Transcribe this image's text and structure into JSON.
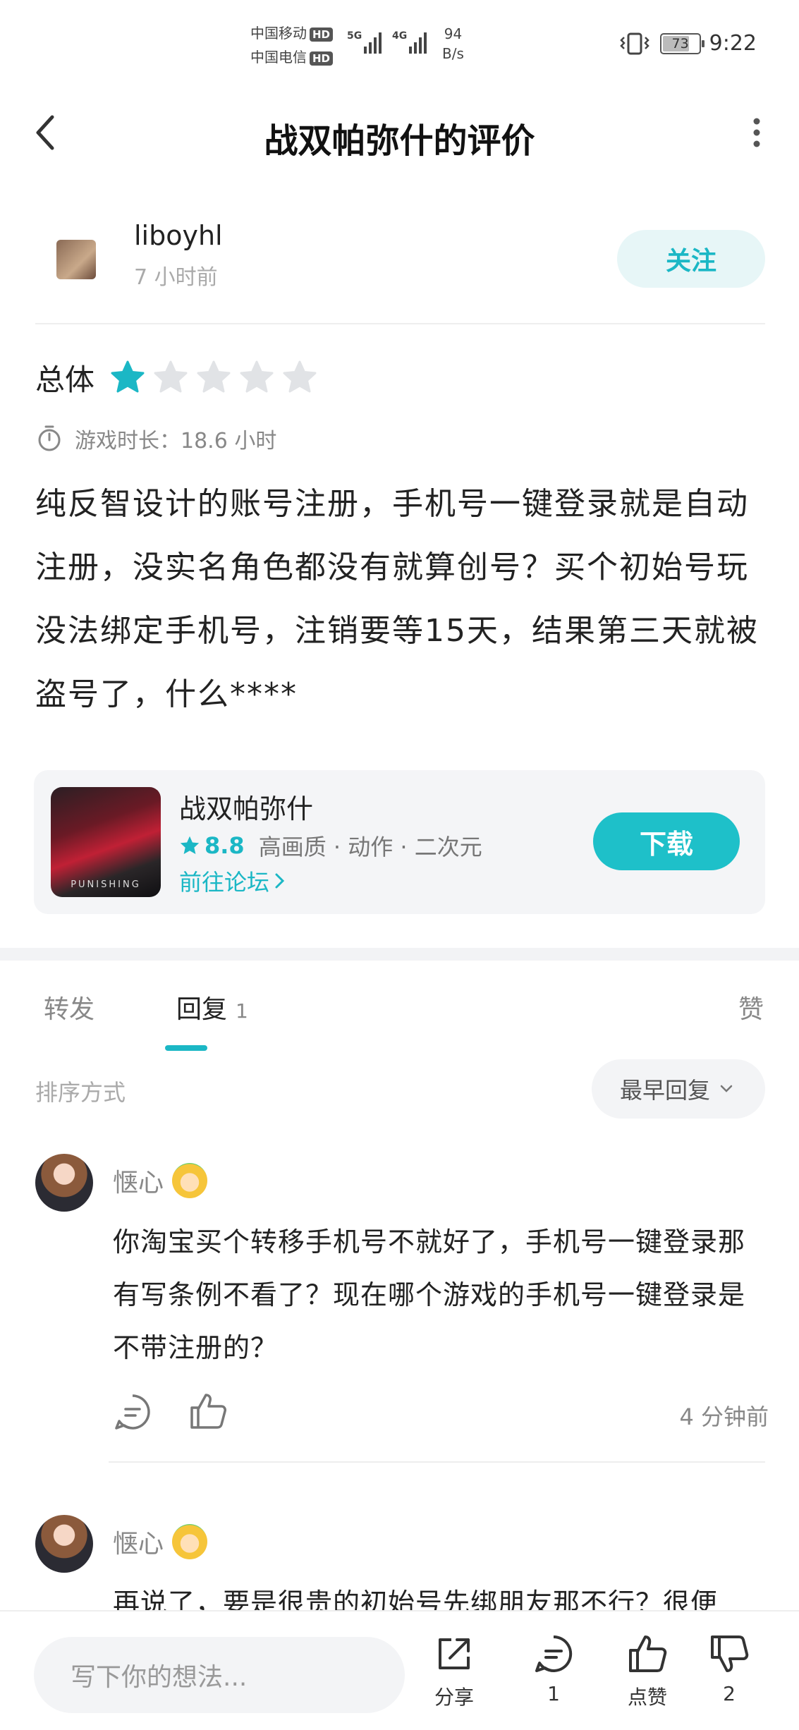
{
  "status_bar": {
    "carrier1": "中国移动",
    "carrier2": "中国电信",
    "hd": "HD",
    "net1": "5G",
    "net2": "4G",
    "speed_value": "94",
    "speed_unit": "B/s",
    "battery": "73",
    "time": "9:22"
  },
  "header": {
    "title": "战双帕弥什的评价"
  },
  "author": {
    "username": "liboyhl",
    "time_ago": "7 小时前",
    "follow_label": "关注"
  },
  "rating": {
    "label": "总体",
    "stars_filled": 1,
    "stars_total": 5,
    "playtime_label": "游戏时长：",
    "playtime_value": "18.6 小时"
  },
  "review": {
    "text": "纯反智设计的账号注册，手机号一键登录就是自动注册，没实名角色都没有就算创号？买个初始号玩没法绑定手机号，注销要等15天，结果第三天就被盗号了，什么****"
  },
  "game_card": {
    "icon_logo": "PUNISHING",
    "name": "战双帕弥什",
    "score": "8.8",
    "tags": "高画质 · 动作 · 二次元",
    "forum_link": "前往论坛",
    "download_label": "下载"
  },
  "tabs": [
    {
      "label": "转发"
    },
    {
      "label": "回复",
      "count": "1"
    },
    {
      "label": "赞"
    }
  ],
  "sort": {
    "label": "排序方式",
    "selected": "最早回复"
  },
  "comments": [
    {
      "name": "惬心",
      "text": "你淘宝买个转移手机号不就好了，手机号一键登录那有写条例不看了？现在哪个游戏的手机号一键登录是不带注册的？",
      "time": "4 分钟前"
    },
    {
      "name": "惬心",
      "text": "再说了，要是很贵的初始号先绑朋友那不行？很便"
    }
  ],
  "bottom_bar": {
    "input_placeholder": "写下你的想法...",
    "share_label": "分享",
    "comment_count": "1",
    "like_label": "点赞",
    "dislike_count": "2"
  },
  "colors": {
    "accent": "#1bb7c5",
    "download_bg": "#1ec0c9",
    "follow_bg": "#e7f6f7"
  }
}
